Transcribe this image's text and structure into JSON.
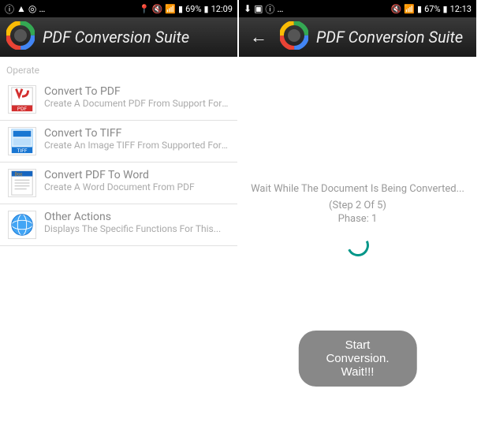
{
  "left": {
    "status": {
      "left_text": "…",
      "battery": "69%",
      "time": "12:09"
    },
    "app_title": "PDF Conversion Suite",
    "section_header": "Operate",
    "items": [
      {
        "title": "Convert To PDF",
        "subtitle": "Create A Document PDF From Support Formats..."
      },
      {
        "title": "Convert To TIFF",
        "subtitle": "Create An Image TIFF From Supported Formats"
      },
      {
        "title": "Convert PDF To Word",
        "subtitle": "Create A Word Document From PDF"
      },
      {
        "title": "Other Actions",
        "subtitle": "Displays The Specific Functions For This..."
      }
    ]
  },
  "right": {
    "status": {
      "left_text": "…",
      "battery": "67%",
      "time": "12:13"
    },
    "app_title": "PDF Conversion Suite",
    "progress": {
      "message": "Wait While The Document Is Being Converted...",
      "step": "(Step 2 Of 5)",
      "phase": "Phase: 1"
    },
    "button_label": "Start Conversion. Wait!!!"
  },
  "colors": {
    "accent": "#009688",
    "appbar": "#222222"
  }
}
